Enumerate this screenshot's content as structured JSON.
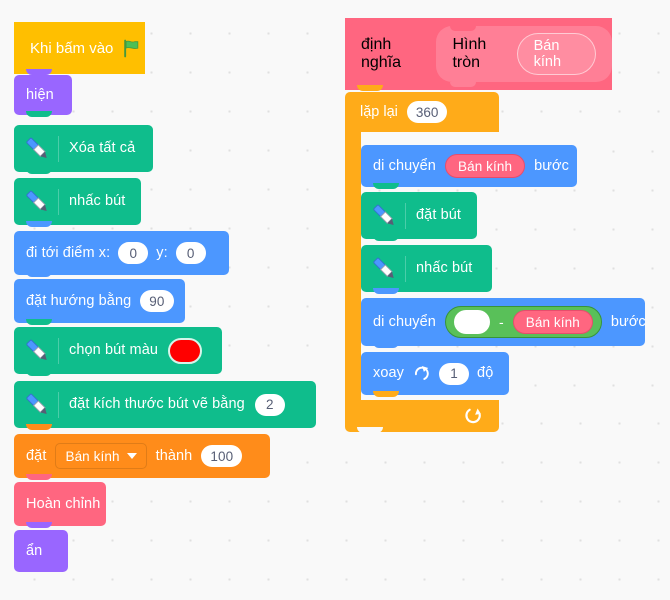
{
  "app": {
    "name": "scratch-block-editor",
    "language": "vi",
    "canvas_background": "#F9F9F9"
  },
  "palette_colors": {
    "events": "#FFBF00",
    "looks": "#9966FF",
    "pen": "#0FBD8C",
    "motion": "#4C97FF",
    "control": "#FFAB19",
    "variables": "#FF8C1A",
    "my_blocks": "#FF6680",
    "operators": "#59C059",
    "pen_color_swatch": "#FF0000"
  },
  "scripts": {
    "main": {
      "hat": {
        "label": "Khi bấm vào",
        "icon": "green-flag-icon"
      },
      "blocks": [
        {
          "id": "show",
          "category": "looks",
          "label": "hiện"
        },
        {
          "id": "erase-all",
          "category": "pen",
          "icon": "pen-icon",
          "label": "Xóa tất cả"
        },
        {
          "id": "pen-up-1",
          "category": "pen",
          "icon": "pen-icon",
          "label": "nhấc bút"
        },
        {
          "id": "goto-xy",
          "category": "motion",
          "label_x": "đi tới điểm x:",
          "value_x": "0",
          "label_y": "y:",
          "value_y": "0"
        },
        {
          "id": "point-direction",
          "category": "motion",
          "label": "đặt hướng bằng",
          "value": "90"
        },
        {
          "id": "set-pen-color",
          "category": "pen",
          "icon": "pen-icon",
          "label": "chọn bút màu",
          "color": "#FF0000"
        },
        {
          "id": "set-pen-size",
          "category": "pen",
          "icon": "pen-icon",
          "label": "đặt kích thước bút vẽ bằng",
          "value": "2"
        },
        {
          "id": "set-variable",
          "category": "variables",
          "label_prefix": "đặt",
          "variable": "Bán kính",
          "label_mid": "thành",
          "value": "100"
        },
        {
          "id": "call-custom",
          "category": "my_blocks",
          "label": "Hoàn chỉnh"
        },
        {
          "id": "hide",
          "category": "looks",
          "label": "ẩn"
        }
      ]
    },
    "definition": {
      "define_label": "định nghĩa",
      "proc_name": "Hình tròn",
      "proc_param": "Bán kính",
      "repeat": {
        "label": "lặp lại",
        "value": "360",
        "loop_icon": "loop-arrow-icon"
      },
      "body": [
        {
          "id": "move-radius",
          "category": "motion",
          "label_prefix": "di chuyển",
          "variable": "Bán kính",
          "label_suffix": "bước"
        },
        {
          "id": "pen-down",
          "category": "pen",
          "icon": "pen-icon",
          "label": "đặt bút"
        },
        {
          "id": "pen-up-2",
          "category": "pen",
          "icon": "pen-icon",
          "label": "nhấc bút"
        },
        {
          "id": "move-sub",
          "category": "motion",
          "label_prefix": "di chuyển",
          "operand_left": "",
          "operator": "-",
          "operand_right": "Bán kính",
          "label_suffix": "bước"
        },
        {
          "id": "turn-right",
          "category": "motion",
          "label_prefix": "xoay",
          "icon": "turn-right-icon",
          "value": "1",
          "label_suffix": "độ"
        }
      ]
    }
  }
}
